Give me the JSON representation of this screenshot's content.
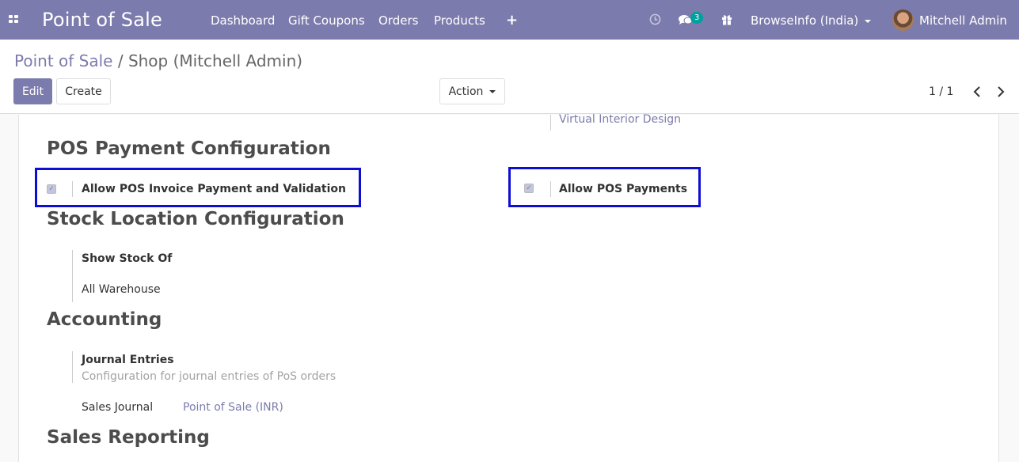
{
  "navbar": {
    "brand": "Point of Sale",
    "menu": [
      "Dashboard",
      "Gift Coupons",
      "Orders",
      "Products"
    ],
    "messages_count": "3",
    "company": "BrowseInfo (India)",
    "user": "Mitchell Admin",
    "colors": {
      "bar": "#7c7bad",
      "badge": "#00a09d"
    }
  },
  "breadcrumb": {
    "parent": "Point of Sale",
    "separator": "/",
    "current": "Shop (Mitchell Admin)"
  },
  "buttons": {
    "edit": "Edit",
    "create": "Create",
    "action": "Action"
  },
  "pager": {
    "value": "1 / 1"
  },
  "form": {
    "top_link": "Virtual Interior Design",
    "payment_section": {
      "title": "POS Payment Configuration",
      "option_left": "Allow POS Invoice Payment and Validation",
      "option_right": "Allow POS Payments"
    },
    "stock_section": {
      "title": "Stock Location Configuration",
      "field_label": "Show Stock Of",
      "field_value": "All Warehouse"
    },
    "accounting_section": {
      "title": "Accounting",
      "field_label": "Journal Entries",
      "field_help": "Configuration for journal entries of PoS orders",
      "journal_label": "Sales Journal",
      "journal_value": "Point of Sale (INR)"
    },
    "reporting_section": {
      "title": "Sales Reporting"
    }
  }
}
